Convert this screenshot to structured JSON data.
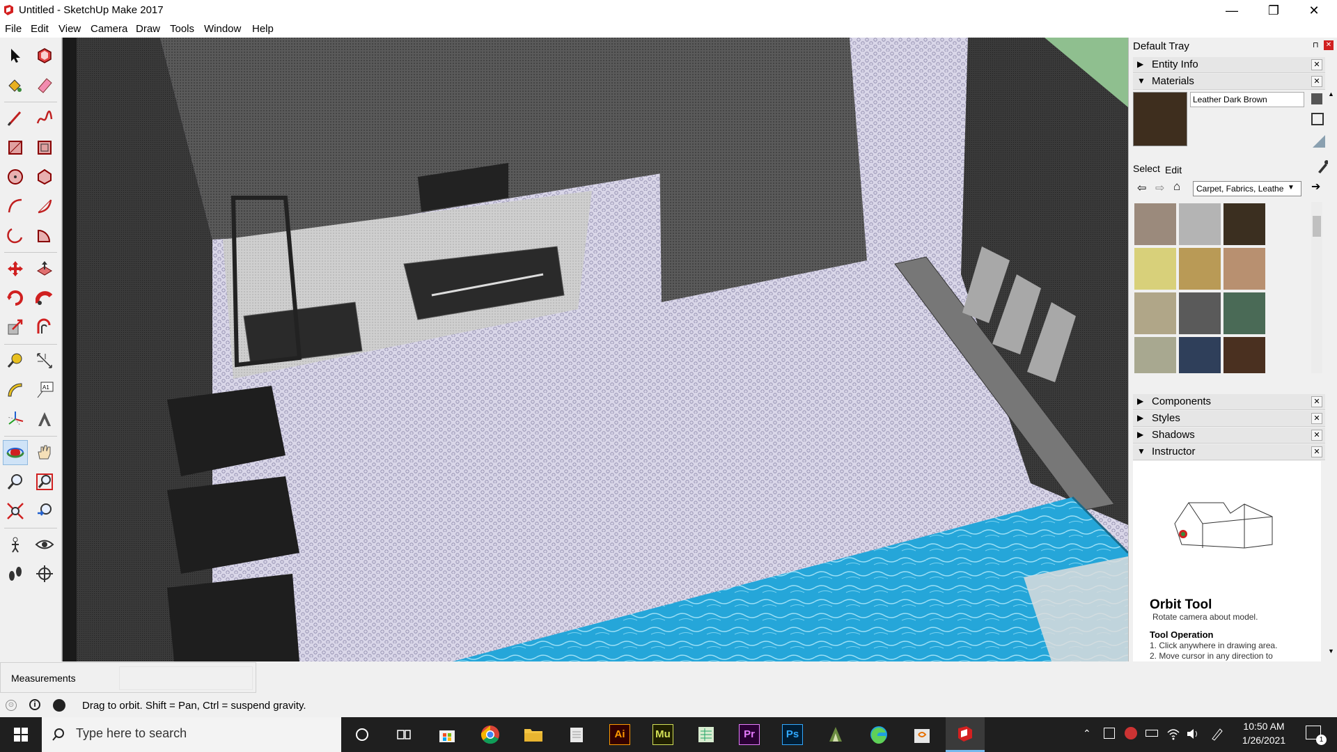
{
  "window": {
    "title": "Untitled - SketchUp Make 2017",
    "minimize": "—",
    "maximize": "❐",
    "close": "✕"
  },
  "menu": [
    "File",
    "Edit",
    "View",
    "Camera",
    "Draw",
    "Tools",
    "Window",
    "Help"
  ],
  "toolbar_icons": [
    "select-icon",
    "make-component-icon",
    "paint-bucket-icon",
    "eraser-icon",
    "line-icon",
    "freehand-icon",
    "rectangle-icon",
    "rotated-rectangle-icon",
    "circle-icon",
    "polygon-icon",
    "arc-icon",
    "two-point-arc-icon",
    "three-point-arc-icon",
    "pie-icon",
    "move-icon",
    "push-pull-icon",
    "rotate-icon",
    "follow-me-icon",
    "scale-icon",
    "offset-icon",
    "tape-measure-icon",
    "dimension-icon",
    "protractor-icon",
    "text-icon",
    "axes-icon",
    "3d-text-icon",
    "orbit-icon",
    "pan-icon",
    "zoom-icon",
    "zoom-window-icon",
    "zoom-extents-icon",
    "previous-view-icon",
    "position-camera-icon",
    "look-around-icon",
    "walk-icon",
    "section-plane-icon"
  ],
  "tray": {
    "title": "Default Tray",
    "pin": "⊓",
    "close": "✕",
    "panels": {
      "entity_info": "Entity Info",
      "materials": "Materials",
      "components": "Components",
      "styles": "Styles",
      "shadows": "Shadows",
      "instructor": "Instructor"
    },
    "material_name": "Leather Dark Brown",
    "tabs": {
      "select": "Select",
      "edit": "Edit"
    },
    "library": "Carpet, Fabrics, Leathe",
    "swatch_colors": [
      "#9b8a7c",
      "#b4b4b4",
      "#3b2f20",
      "#d8d07a",
      "#b99a56",
      "#b89070",
      "#b0a688",
      "#5a5a5a",
      "#4a6a56",
      "#a8a890",
      "#2f3f5a",
      "#4a3020"
    ]
  },
  "instructor": {
    "tool_title": "Orbit Tool",
    "tool_desc": "Rotate camera about model.",
    "op_title": "Tool Operation",
    "op_1": "1.  Click anywhere in drawing area.",
    "op_2": "2.  Move cursor in any direction to"
  },
  "measurements": {
    "label": "Measurements",
    "value": ""
  },
  "status": {
    "hint": "Drag to orbit. Shift = Pan, Ctrl = suspend gravity."
  },
  "taskbar": {
    "search_placeholder": "Type here to search",
    "apps": [
      "task-view",
      "file-explorer-folder",
      "store",
      "chrome",
      "file-explorer",
      "notepad",
      "illustrator",
      "muse",
      "excel",
      "premiere",
      "photoshop",
      "app-2018",
      "edge",
      "java",
      "sketchup"
    ],
    "app_labels": {
      "ai": "Ai",
      "mu": "Mu",
      "pr": "Pr",
      "ps": "Ps"
    },
    "time": "10:50 AM",
    "date": "1/26/2021",
    "notifications": "1"
  }
}
